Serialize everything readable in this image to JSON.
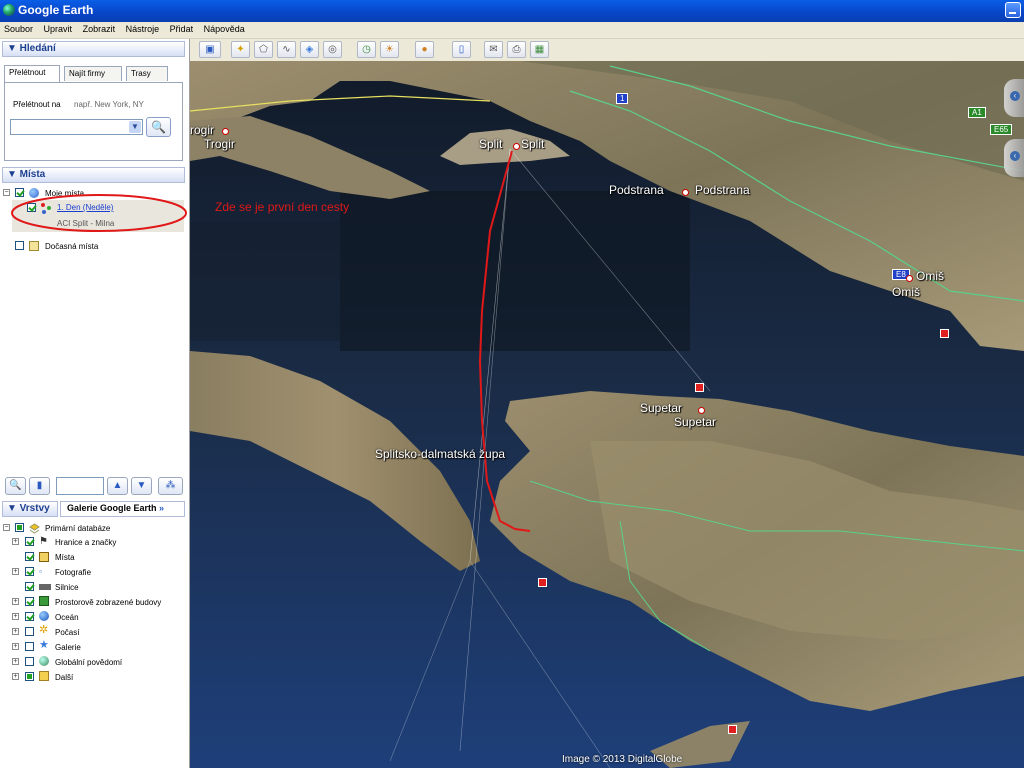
{
  "window": {
    "title": "Google Earth"
  },
  "menu": [
    "Soubor",
    "Upravit",
    "Zobrazit",
    "Nástroje",
    "Přidat",
    "Nápověda"
  ],
  "search": {
    "header": "▼ Hledání",
    "tabs": [
      "Přelétnout",
      "Najít firmy",
      "Trasy"
    ],
    "fly_label": "Přelétnout na",
    "fly_hint": "např. New York, NY",
    "input_value": ""
  },
  "places": {
    "header": "▼ Místa",
    "my_places": "Moje místa",
    "day1": "1. Den (Neděle)",
    "day1_desc": "ACI Split - Milna",
    "temp_places": "Dočasná místa"
  },
  "layers": {
    "header": "▼ Vrstvy",
    "gallery_tab": "Galerie Google Earth",
    "gallery_arrows": "»",
    "items": [
      "Primární databáze",
      "Hranice a značky",
      "Místa",
      "Fotografie",
      "Silnice",
      "Prostorově zobrazené budovy",
      "Oceán",
      "Počasí",
      "Galerie",
      "Globální povědomí",
      "Další"
    ]
  },
  "map": {
    "annotation": "Zde se je první den cesty",
    "labels": {
      "trogir": "Trogir",
      "trogir_edge": "rogir",
      "split1": "Split",
      "split2": "Split",
      "podstrana1": "Podstrana",
      "podstrana2": "Podstrana",
      "omis1": "Omiš",
      "omis2": "Omiš",
      "supetar1": "Supetar",
      "supetar2": "Supetar",
      "zupa": "Splitsko-dalmatská župa"
    },
    "road_shields": [
      "1",
      "A1",
      "E65",
      "E8"
    ],
    "credit": "Image © 2013 DigitalGlobe"
  },
  "colors": {
    "route": "#e01818",
    "annotation": "#e01818",
    "sea": "#1d3050",
    "land": "#8a7a55"
  }
}
